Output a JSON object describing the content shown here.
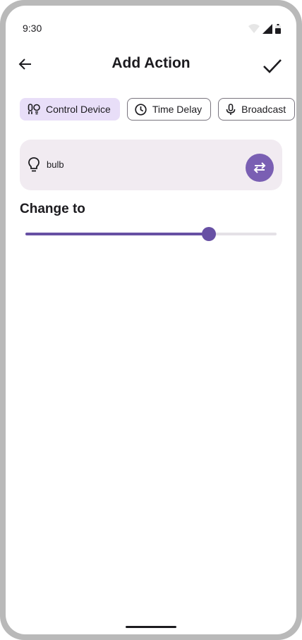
{
  "status_bar": {
    "time": "9:30",
    "icons": [
      "wifi-icon",
      "cellular-icon",
      "battery-icon"
    ]
  },
  "app_bar": {
    "title": "Add Action",
    "back_icon": "arrow-back-icon",
    "confirm_icon": "check-icon"
  },
  "chips": [
    {
      "label": "Control Device",
      "icon": "devices-icon",
      "selected": true
    },
    {
      "label": "Time Delay",
      "icon": "clock-icon",
      "selected": false
    },
    {
      "label": "Broadcast",
      "icon": "microphone-icon",
      "selected": false
    }
  ],
  "device": {
    "name": "bulb",
    "icon": "lightbulb-icon",
    "swap_icon": "swap-horizontal-icon"
  },
  "change_to": {
    "label": "Change to",
    "slider_value": 0.73
  },
  "colors": {
    "accent": "#6750a4",
    "chip_selected_bg": "#e8def8",
    "card_bg": "#f1ebf1",
    "swap_button": "#7a5fb3"
  }
}
